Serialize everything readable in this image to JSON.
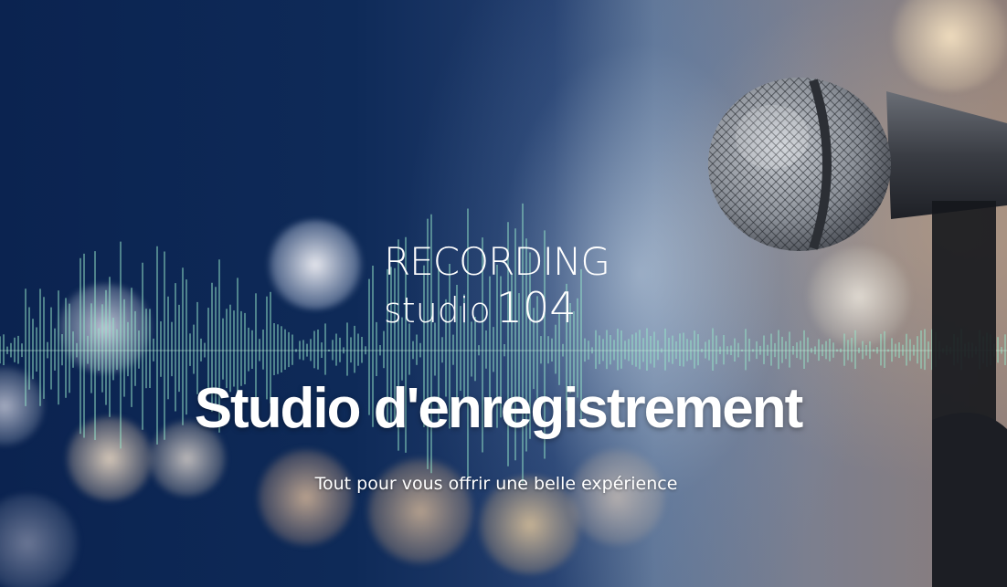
{
  "logo": {
    "line1": "RECORDING",
    "line2_word": "studio",
    "line2_number": "104"
  },
  "hero": {
    "heading": "Studio d'enregistrement",
    "tagline": "Tout pour vous offrir une belle expérience"
  },
  "icons": {
    "background": "microphone-icon"
  },
  "colors": {
    "background_dark": "#0d2248",
    "text": "#ffffff"
  }
}
